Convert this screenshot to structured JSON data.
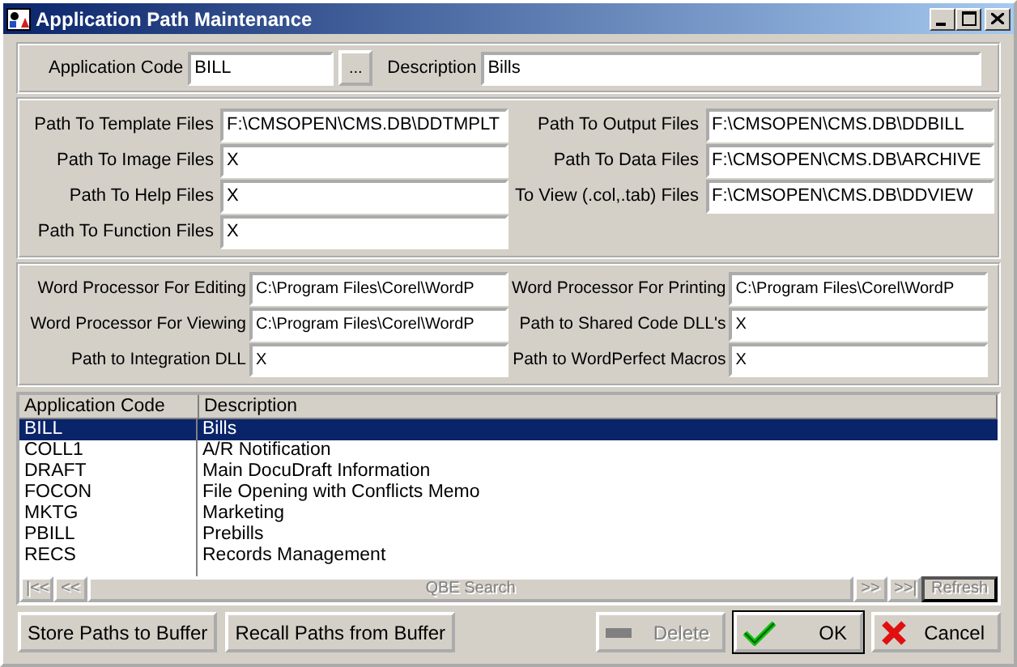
{
  "window": {
    "title": "Application Path Maintenance"
  },
  "header": {
    "code_label": "Application Code",
    "code_value": "BILL",
    "lookup_button": "...",
    "description_label": "Description",
    "description_value": "Bills"
  },
  "paths_left": [
    {
      "label": "Path To Template Files",
      "value": "F:\\CMSOPEN\\CMS.DB\\DDTMPLT"
    },
    {
      "label": "Path To Image Files",
      "value": "X"
    },
    {
      "label": "Path To Help Files",
      "value": "X"
    },
    {
      "label": "Path To Function Files",
      "value": "X"
    }
  ],
  "paths_right": [
    {
      "label": "Path To Output Files",
      "value": "F:\\CMSOPEN\\CMS.DB\\DDBILL"
    },
    {
      "label": "Path To Data Files",
      "value": "F:\\CMSOPEN\\CMS.DB\\ARCHIVE"
    },
    {
      "label": "To View (.col,.tab) Files",
      "value": "F:\\CMSOPEN\\CMS.DB\\DDVIEW"
    }
  ],
  "programs_left": [
    {
      "label": "Word Processor For Editing",
      "value": "C:\\Program Files\\Corel\\WordP"
    },
    {
      "label": "Word Processor For Viewing",
      "value": "C:\\Program Files\\Corel\\WordP"
    },
    {
      "label": "Path to Integration DLL",
      "value": "X"
    }
  ],
  "programs_right": [
    {
      "label": "Word Processor For Printing",
      "value": "C:\\Program Files\\Corel\\WordP"
    },
    {
      "label": "Path to Shared Code DLL's",
      "value": "X"
    },
    {
      "label": "Path to WordPerfect Macros",
      "value": "X"
    }
  ],
  "list": {
    "columns": [
      "Application Code",
      "Description"
    ],
    "rows": [
      {
        "code": "BILL",
        "description": "Bills",
        "selected": true
      },
      {
        "code": "COLL1",
        "description": "A/R Notification",
        "selected": false
      },
      {
        "code": "DRAFT",
        "description": "Main DocuDraft Information",
        "selected": false
      },
      {
        "code": "FOCON",
        "description": "File Opening with Conflicts Memo",
        "selected": false
      },
      {
        "code": "MKTG",
        "description": "Marketing",
        "selected": false
      },
      {
        "code": "PBILL",
        "description": "Prebills",
        "selected": false
      },
      {
        "code": "RECS",
        "description": "Records Management",
        "selected": false
      }
    ]
  },
  "navigator": {
    "left": [
      {
        "label": "|<<",
        "disabled": true
      },
      {
        "label": "<<",
        "disabled": true
      }
    ],
    "search": {
      "label": "QBE Search",
      "disabled": true
    },
    "right": [
      {
        "label": ">>",
        "disabled": true
      },
      {
        "label": ">>|",
        "disabled": true
      }
    ],
    "refresh": {
      "label": "Refresh",
      "disabled": true
    }
  },
  "buttons_left": [
    {
      "label": "Store Paths to Buffer",
      "disabled": false
    },
    {
      "label": "Recall Paths from Buffer",
      "disabled": false
    }
  ],
  "buttons_right": [
    {
      "label": "Delete",
      "kind": "delete",
      "disabled": true
    },
    {
      "label": "OK",
      "kind": "ok",
      "disabled": false
    },
    {
      "label": "Cancel",
      "kind": "cancel",
      "disabled": false
    }
  ]
}
